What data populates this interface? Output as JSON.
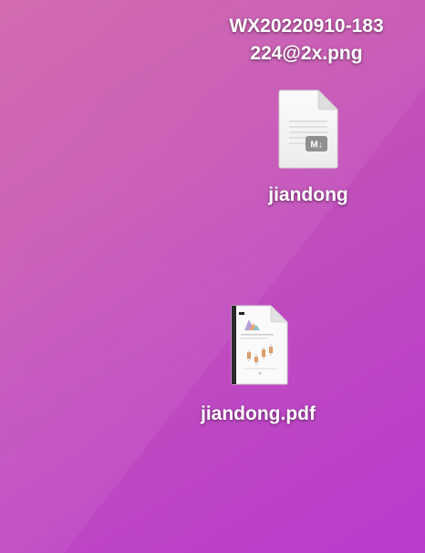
{
  "desktop": {
    "background_colors": [
      "#cc5aa8",
      "#c04cbf",
      "#b83ccd"
    ],
    "files": [
      {
        "name_line1": "WX20220910-183",
        "name_line2": "224@2x.png",
        "icon": "image-file-icon"
      },
      {
        "name": "jiandong",
        "icon": "markdown-document-icon",
        "badge": "M↓"
      },
      {
        "name": "jiandong.pdf",
        "icon": "pdf-document-thumbnail-icon"
      }
    ]
  }
}
